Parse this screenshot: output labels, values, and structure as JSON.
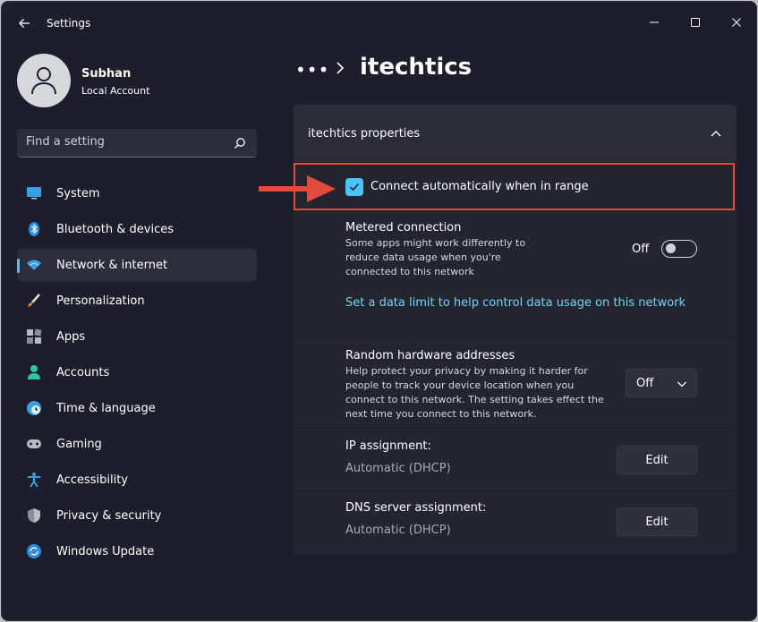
{
  "window": {
    "title": "Settings"
  },
  "profile": {
    "name": "Subhan",
    "account_type": "Local Account"
  },
  "search": {
    "placeholder": "Find a setting"
  },
  "nav": {
    "items": [
      {
        "label": "System",
        "icon": "monitor-icon",
        "active": false
      },
      {
        "label": "Bluetooth & devices",
        "icon": "bluetooth-icon",
        "active": false
      },
      {
        "label": "Network & internet",
        "icon": "wifi-icon",
        "active": true
      },
      {
        "label": "Personalization",
        "icon": "brush-icon",
        "active": false
      },
      {
        "label": "Apps",
        "icon": "apps-icon",
        "active": false
      },
      {
        "label": "Accounts",
        "icon": "person-icon",
        "active": false
      },
      {
        "label": "Time & language",
        "icon": "globe-clock-icon",
        "active": false
      },
      {
        "label": "Gaming",
        "icon": "gamepad-icon",
        "active": false
      },
      {
        "label": "Accessibility",
        "icon": "accessibility-icon",
        "active": false
      },
      {
        "label": "Privacy & security",
        "icon": "shield-icon",
        "active": false
      },
      {
        "label": "Windows Update",
        "icon": "update-icon",
        "active": false
      }
    ]
  },
  "header": {
    "breadcrumb_more": "•••",
    "title": "itechtics"
  },
  "panel": {
    "title": "itechtics properties",
    "auto_connect": {
      "label": "Connect automatically when in range",
      "checked": true
    },
    "metered": {
      "title": "Metered connection",
      "description": "Some apps might work differently to reduce data usage when you're connected to this network",
      "toggle_label": "Off",
      "toggle_on": false
    },
    "data_limit_link": "Set a data limit to help control data usage on this network",
    "random_hw": {
      "title": "Random hardware addresses",
      "description": "Help protect your privacy by making it harder for people to track your device location when you connect to this network. The setting takes effect the next time you connect to this network.",
      "value": "Off"
    },
    "ip_assignment": {
      "title": "IP assignment:",
      "value": "Automatic (DHCP)",
      "button": "Edit"
    },
    "dns_assignment": {
      "title": "DNS server assignment:",
      "value": "Automatic (DHCP)",
      "button": "Edit"
    }
  },
  "colors": {
    "accent": "#4cc2ff",
    "highlight_box": "#e24a3b",
    "arrow": "#e24a3b",
    "link": "#78d0f5"
  }
}
